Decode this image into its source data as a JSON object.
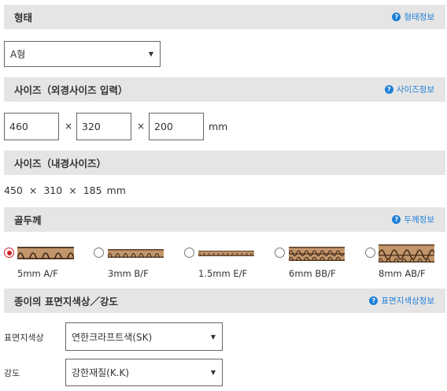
{
  "type_section": {
    "title": "형태",
    "info_link": "형태정보",
    "select_value": "A형"
  },
  "outer_size_section": {
    "title": "사이즈（외경사이즈 입력）",
    "info_link": "사이즈정보",
    "width": "460",
    "depth": "320",
    "height": "200",
    "times": "×",
    "unit": "mm"
  },
  "inner_size_section": {
    "title": "사이즈（내경사이즈）",
    "width": "450",
    "depth": "310",
    "height": "185",
    "times": "×",
    "unit": "mm"
  },
  "flute_section": {
    "title": "골두께",
    "info_link": "두께정보",
    "options": [
      {
        "label": "5mm A/F",
        "selected": true
      },
      {
        "label": "3mm B/F",
        "selected": false
      },
      {
        "label": "1.5mm E/F",
        "selected": false
      },
      {
        "label": "6mm BB/F",
        "selected": false
      },
      {
        "label": "8mm AB/F",
        "selected": false
      }
    ]
  },
  "paper_section": {
    "title": "종이의 표면지색상／강도",
    "info_link": "표면지색상정보",
    "surface_label": "표면지색상",
    "surface_value": "연한크라프트색(SK)",
    "strength_label": "강도",
    "strength_value": "강한재질(K.K)"
  },
  "colors": {
    "accent_blue": "#1e7fd8",
    "radio_selected": "#d21f24",
    "header_bg": "#e5e5e5",
    "kraft": "#c2956a"
  }
}
